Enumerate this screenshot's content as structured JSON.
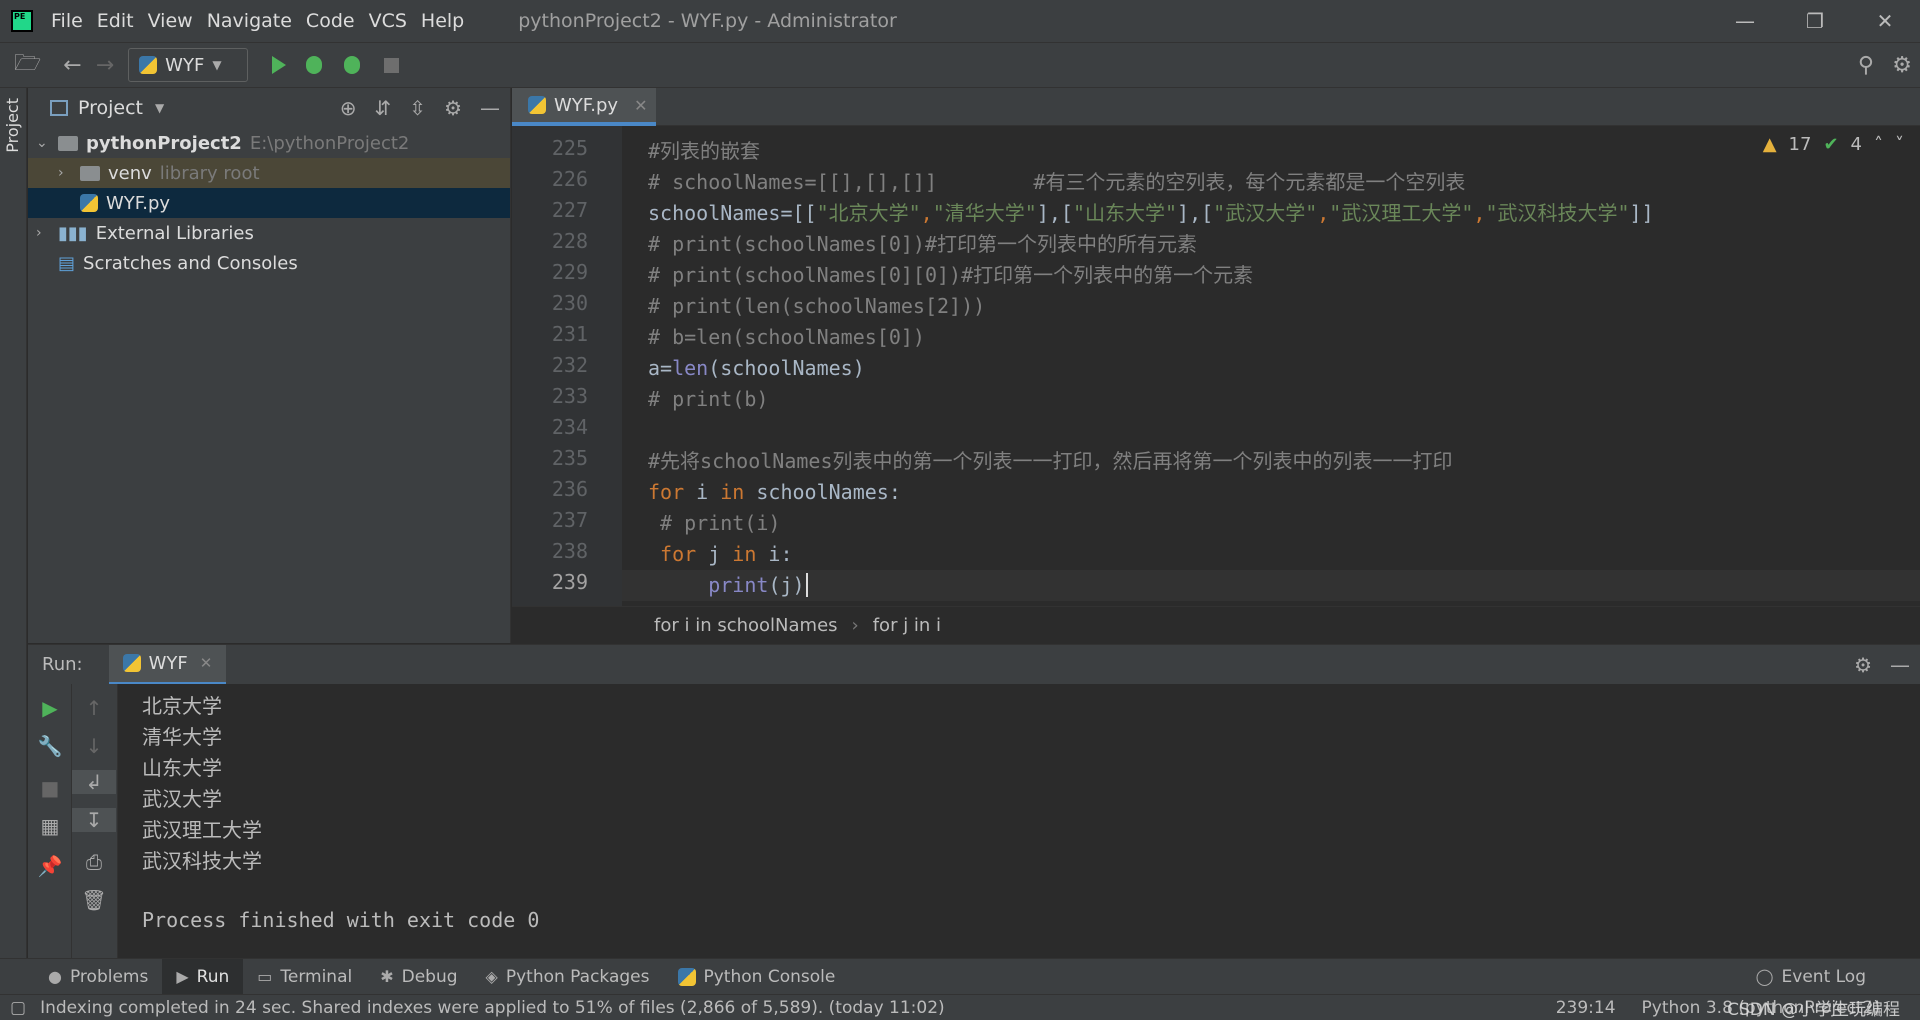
{
  "menu": [
    "File",
    "Edit",
    "View",
    "Navigate",
    "Code",
    "VCS",
    "Help"
  ],
  "window_title": "pythonProject2 - WYF.py - Administrator",
  "toolbar": {
    "run_config": "WYF"
  },
  "left_strip": {
    "project_label": "Project"
  },
  "project": {
    "header": "Project",
    "tree": {
      "root_name": "pythonProject2",
      "root_path": "E:\\pythonProject2",
      "venv": "venv",
      "venv_note": "library root",
      "file": "WYF.py",
      "ext_libs": "External Libraries",
      "scratches": "Scratches and Consoles"
    }
  },
  "editor": {
    "tab": "WYF.py",
    "warnings": "17",
    "weak_warnings": "4",
    "lines": [
      "225",
      "226",
      "227",
      "228",
      "229",
      "230",
      "231",
      "232",
      "233",
      "234",
      "235",
      "236",
      "237",
      "238",
      "239"
    ],
    "code": {
      "l225": "#列表的嵌套",
      "l226a": "# schoolNames=[[],[],[]]",
      "l226b": "        #有三个元素的空列表，每个元素都是一个空列表",
      "l227_name": "schoolNames=[[",
      "l227_s1": "\"北京大学\"",
      "l227_c1": ",",
      "l227_s2": "\"清华大学\"",
      "l227_b1": "],[",
      "l227_s3": "\"山东大学\"",
      "l227_b2": "],[",
      "l227_s4": "\"武汉大学\"",
      "l227_c2": ",",
      "l227_s5": "\"武汉理工大学\"",
      "l227_c3": ",",
      "l227_s6": "\"武汉科技大学\"",
      "l227_end": "]]",
      "l228": "# print(schoolNames[0])#打印第一个列表中的所有元素",
      "l229": "# print(schoolNames[0][0])#打印第一个列表中的第一个元素",
      "l230": "# print(len(schoolNames[2]))",
      "l231": "# b=len(schoolNames[0])",
      "l232_a": "a=",
      "l232_fn": "len",
      "l232_b": "(schoolNames)",
      "l233": "# print(b)",
      "l235": "#先将schoolNames列表中的第一个列表一一打印，然后再将第一个列表中的列表一一打印",
      "l236_kw1": "for",
      "l236_a": " i ",
      "l236_kw2": "in",
      "l236_b": " schoolNames:",
      "l237": " # print(i)",
      "l238_kw1": " for",
      "l238_a": " j ",
      "l238_kw2": "in",
      "l238_b": " i:",
      "l239_indent": "     ",
      "l239_fn": "print",
      "l239_b": "(j)"
    },
    "breadcrumb": [
      "for i in schoolNames",
      "for j in i"
    ]
  },
  "run": {
    "label": "Run:",
    "tab": "WYF",
    "output": [
      "北京大学",
      "清华大学",
      "山东大学",
      "武汉大学",
      "武汉理工大学",
      "武汉科技大学"
    ],
    "exit": "Process finished with exit code 0"
  },
  "tool_tabs": [
    "Problems",
    "Run",
    "Terminal",
    "Debug",
    "Python Packages",
    "Python Console"
  ],
  "event_log": "Event Log",
  "status": {
    "message": "Indexing completed in 24 sec. Shared indexes were applied to 51% of files (2,866 of 5,589). (today 11:02)",
    "position": "239:14",
    "interpreter": "Python 3.8 (pythonProject2)",
    "watermark": "CSDN @小学生玩编程"
  },
  "colors": {
    "accent": "#4a88c7",
    "keyword": "#cc7832",
    "string": "#6a8759",
    "comment": "#808080",
    "builtin": "#8888c6"
  }
}
